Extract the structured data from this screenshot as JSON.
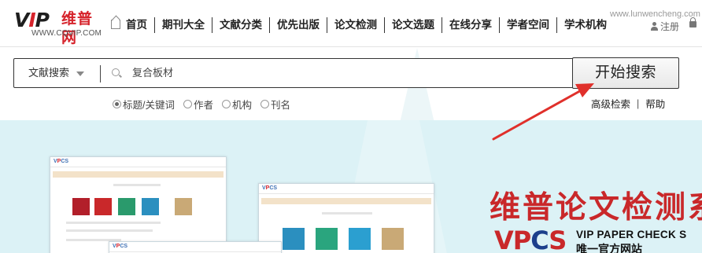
{
  "nav": {
    "logo_text": "VIP",
    "logo_cn": "维普网",
    "logo_url": "WWW.CQVIP.COM",
    "items": [
      "首页",
      "期刊大全",
      "文献分类",
      "优先出版",
      "论文检测",
      "论文选题",
      "在线分享",
      "学者空间",
      "学术机构"
    ],
    "register": "注册",
    "site_url": "www.lunwencheng.com"
  },
  "search": {
    "scope": "文献搜索",
    "query": "复合板材",
    "submit": "开始搜索",
    "options": [
      "标题/关键词",
      "作者",
      "机构",
      "刊名"
    ],
    "selected_option": "标题/关键词",
    "advanced": "高级检索",
    "help": "帮助"
  },
  "banner": {
    "title": "维普论文检测系",
    "logo": "VPCS",
    "subtitle_en": "VIP PAPER CHECK S",
    "subtitle_cn": "唯一官方网站"
  },
  "colors": {
    "brand_red": "#d6232b",
    "banner_bg": "#dcf2f6",
    "arrow": "#e0302b"
  }
}
